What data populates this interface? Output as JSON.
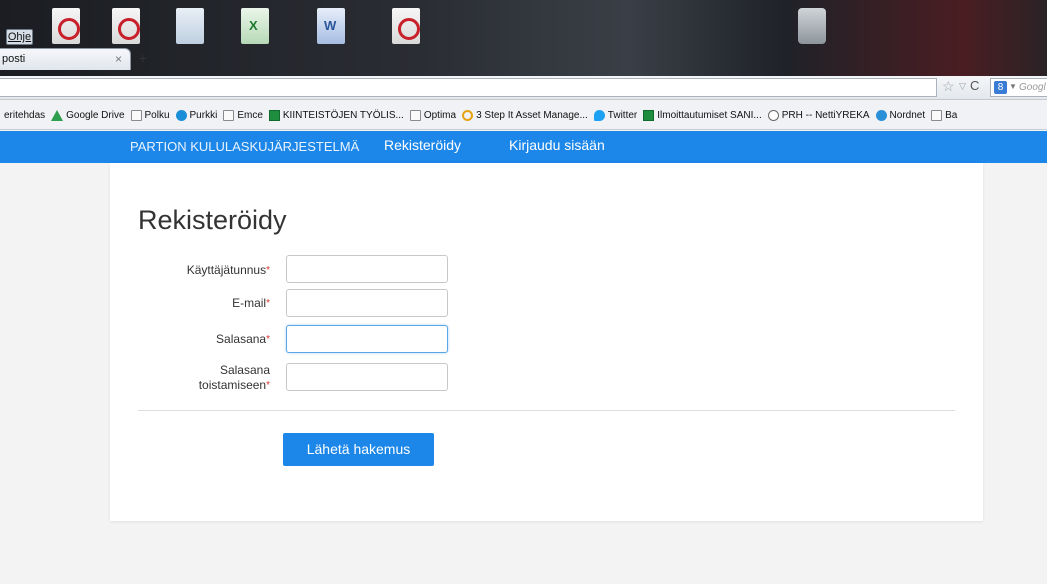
{
  "browser": {
    "menu_help": "Ohje",
    "tab_title": "posti",
    "tab_close": "×",
    "tab_new": "+",
    "search_placeholder": "Googl",
    "search_engine_icon": "google-icon"
  },
  "bookmarks": [
    {
      "icon": "folder-icon",
      "label": "eritehdas"
    },
    {
      "icon": "google-drive-icon",
      "label": "Google Drive"
    },
    {
      "icon": "folder-icon",
      "label": "Polku"
    },
    {
      "icon": "purkki-icon",
      "label": "Purkki"
    },
    {
      "icon": "folder-icon",
      "label": "Emce"
    },
    {
      "icon": "spreadsheet-icon",
      "label": "KIINTEISTÖJEN TYÖLIS..."
    },
    {
      "icon": "folder-icon",
      "label": "Optima"
    },
    {
      "icon": "optima-icon",
      "label": "3 Step It Asset Manage..."
    },
    {
      "icon": "twitter-icon",
      "label": "Twitter"
    },
    {
      "icon": "spreadsheet-icon",
      "label": "Ilmoittautumiset SANI..."
    },
    {
      "icon": "prh-icon",
      "label": "PRH -- NettiYREKA"
    },
    {
      "icon": "nordnet-icon",
      "label": "Nordnet"
    },
    {
      "icon": "folder-icon",
      "label": "Ba"
    }
  ],
  "nav": {
    "brand": "PARTION KULULASKUJÄRJESTELMÄ",
    "register": "Rekisteröidy",
    "login": "Kirjaudu sisään"
  },
  "form": {
    "title": "Rekisteröidy",
    "required_mark": "*",
    "username_label": "Käyttäjätunnus",
    "email_label": "E-mail",
    "password_label": "Salasana",
    "password_repeat_label_1": "Salasana",
    "password_repeat_label_2": "toistamiseen",
    "username_value": "",
    "email_value": "",
    "password_value": "",
    "password_repeat_value": "",
    "submit_label": "Lähetä hakemus"
  },
  "colors": {
    "accent": "#1c87e8",
    "required": "#d9302f"
  }
}
